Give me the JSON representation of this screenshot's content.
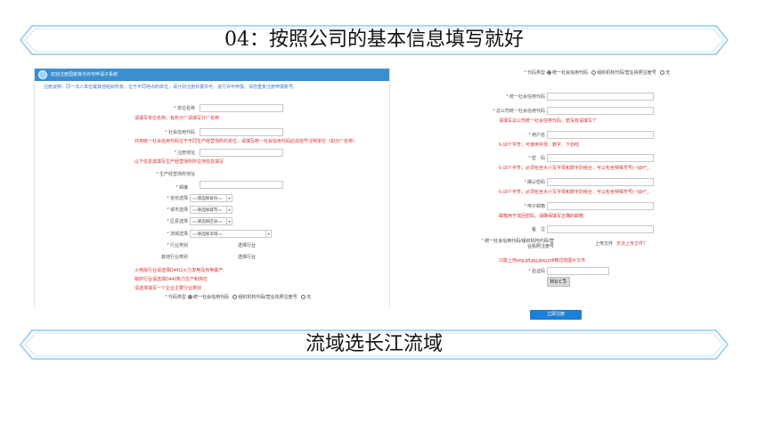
{
  "banners": {
    "top_title": "04：按照公司的基本信息填写就好",
    "bottom_title": "流域选长江流域",
    "stroke_color": "#8ec8ee"
  },
  "left_form": {
    "header_title": "欢迎注册国家排污许可申请子系统",
    "note": "注册说明：同一法人单位或其他组织所有，位于不同地点的单位，请分别注册并报许可，进行许可申报。请您重复注册申报账号。",
    "unit_name_label": "单位名称",
    "unit_name_hint": "请填写单位名称，有些分厂请填写分厂名称",
    "credit_code_label": "社会信用代码",
    "credit_code_hint": "共用统一社会信用代码位于不同生产经营场所的单位，请填写统一社会信用代码后加括号注明单位（如分厂名称）",
    "reg_address_label": "注册地址",
    "reg_address_hint": "以下信息需填写生产经营场所所在地信息填写",
    "prod_address_label": "生产经营场所地址",
    "postal_label": "邮编",
    "province_label": "省份选择",
    "province_value": "==请选择省份==",
    "city_label": "城市选择",
    "city_value": "==请选择城市==",
    "district_label": "区县选择",
    "district_value": "==请选择区县==",
    "basin_label": "流域选择",
    "basin_value": "==请选择流域==",
    "industry_label": "行业类别",
    "industry_select": "选择行业",
    "other_industry_label": "其他行业类别",
    "other_industry_select": "选择行业",
    "notes": [
      "火电除行业请选择D4411火力发电及热电联产",
      "锅炉行业请选择D443热力生产和供应",
      "请选择填写一个企业主要行业类别"
    ],
    "code_type_label": "代码类型",
    "code_type_options": [
      "统一社会信用代码",
      "组织机构代码/营业执照注册号",
      "无"
    ]
  },
  "right_form": {
    "code_type_label": "代码类型",
    "code_type_options": [
      "统一社会信用代码",
      "组织机构代码/营业执照注册号",
      "无"
    ],
    "credit_code_label": "统一社会信用代码",
    "parent_code_label": "总公司统一社会信用代码",
    "parent_code_hint": "请填写总公司统一社会信用代码，若没有请填写“/”",
    "username_label": "用户名",
    "username_hint": "6-18个字符，可使用字母、数字、下划线",
    "password_label": "密　码",
    "password_hint": "6-18个字符，必须包含大小写字母和数字的组合，可以包含特殊符号(~!@#*_.",
    "confirm_label": "确认密码",
    "confirm_hint": "6-18个字符，必须包含大小写字母和数字的组合，可以包含特殊符号(~!@#*_.",
    "email_label": "电子邮箱",
    "email_hint": "邮箱用于找回密码，请确保填写正确的邮箱",
    "remark_label": "备　注",
    "upload_label": "统一社会信用代码/组织机构代码/营业执照注册号",
    "upload_button": "上传文件",
    "upload_status": "无法上传文件？",
    "upload_hint": "只能上传png,gif,jpg,jpeg,pdf格式的图片文件",
    "captcha_label": "验证码",
    "captcha_text": "Hoc5",
    "submit_label": "立即注册"
  }
}
